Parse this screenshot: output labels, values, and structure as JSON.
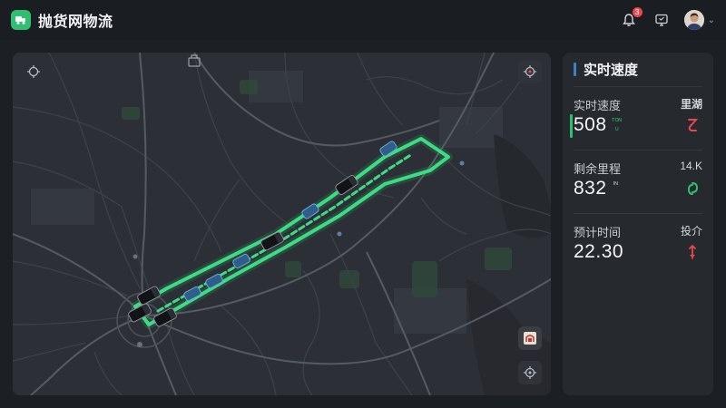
{
  "header": {
    "app_title": "抛货网物流",
    "notification_count": "3"
  },
  "map": {
    "icons": [
      "crosshair-icon",
      "locate-icon",
      "layers-icon",
      "gps-icon"
    ]
  },
  "panel": {
    "title": "实时速度",
    "stats": [
      {
        "label": "实时速度",
        "value": "508",
        "unit": "里湖",
        "sub_top": "ᵀᴼᴺ",
        "sub_bottom": "ᵁ",
        "indicator_color": "#e5484d"
      },
      {
        "label": "剩余里程",
        "value": "832",
        "unit": "14.K",
        "sub_top": "ᴵᴺ",
        "indicator_color": "#2fbf71"
      },
      {
        "label": "预计时间",
        "value": "22.30",
        "unit": "投介",
        "indicator_color": "#e5484d"
      }
    ]
  },
  "colors": {
    "accent_green": "#2fbf71",
    "alert_red": "#e5484d",
    "header_bar_blue": "#3b82c4"
  }
}
